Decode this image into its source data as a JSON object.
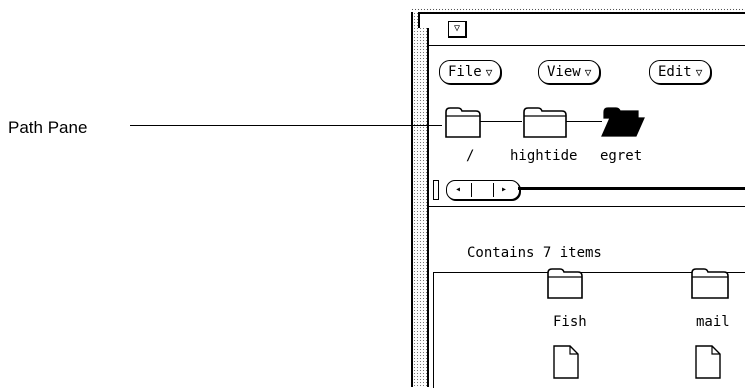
{
  "callout": {
    "label": "Path Pane"
  },
  "window": {
    "menu_glyph": "▽"
  },
  "menus": [
    {
      "label": "File",
      "arrow": "▽"
    },
    {
      "label": "View",
      "arrow": "▽"
    },
    {
      "label": "Edit",
      "arrow": "▽"
    }
  ],
  "path": [
    {
      "label": "/",
      "icon": "folder-icon",
      "selected": false
    },
    {
      "label": "hightide",
      "icon": "folder-icon",
      "selected": false
    },
    {
      "label": "egret",
      "icon": "open-folder-icon",
      "selected": true
    }
  ],
  "scrollbar": {
    "left_glyph": "◂",
    "right_glyph": "▸"
  },
  "status": {
    "text": "Contains 7 items"
  },
  "items": [
    {
      "label": "Fish",
      "icon": "folder-icon"
    },
    {
      "label": "mail",
      "icon": "folder-icon"
    },
    {
      "label": "",
      "icon": "document-icon"
    },
    {
      "label": "",
      "icon": "document-icon"
    }
  ]
}
